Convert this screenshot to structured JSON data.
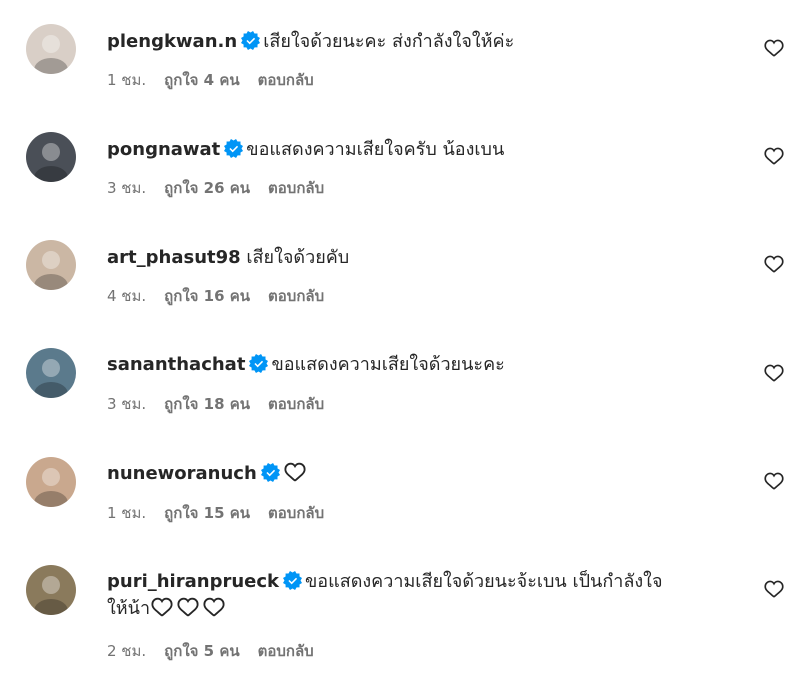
{
  "comments": [
    {
      "username": "plengkwan.n",
      "verified": true,
      "text": "เสียใจด้วยนะคะ ส่งกำลังใจให้ค่ะ",
      "text2": "",
      "hearts": 0,
      "time": "1 ชม.",
      "likes": "ถูกใจ 4 คน",
      "reply": "ตอบกลับ",
      "avatar_color": "#d9cfc7"
    },
    {
      "username": "pongnawat",
      "verified": true,
      "text": "ขอแสดงความเสียใจครับ น้องเบน",
      "text2": "",
      "hearts": 0,
      "time": "3 ชม.",
      "likes": "ถูกใจ 26 คน",
      "reply": "ตอบกลับ",
      "avatar_color": "#4a4f57"
    },
    {
      "username": "art_phasut98",
      "verified": false,
      "text": "เสียใจด้วยคับ",
      "text2": "",
      "hearts": 0,
      "time": "4 ชม.",
      "likes": "ถูกใจ 16 คน",
      "reply": "ตอบกลับ",
      "avatar_color": "#cbb7a4"
    },
    {
      "username": "sananthachat",
      "verified": true,
      "text": "ขอแสดงความเสียใจด้วยนะคะ",
      "text2": "",
      "hearts": 0,
      "time": "3 ชม.",
      "likes": "ถูกใจ 18 คน",
      "reply": "ตอบกลับ",
      "avatar_color": "#5b7a8c"
    },
    {
      "username": "nuneworanuch",
      "verified": true,
      "text": "",
      "text2": "",
      "hearts": 1,
      "time": "1 ชม.",
      "likes": "ถูกใจ 15 คน",
      "reply": "ตอบกลับ",
      "avatar_color": "#c9a88e"
    },
    {
      "username": "puri_hiranprueck",
      "verified": true,
      "text": "ขอแสดงความเสียใจด้วยนะจ้ะเบน เป็นกำลังใจ",
      "text2": "ให้น้า",
      "hearts": 3,
      "time": "2 ชม.",
      "likes": "ถูกใจ 5 คน",
      "reply": "ตอบกลับ",
      "avatar_color": "#8a7a5c"
    }
  ],
  "icons": {
    "verified": "verified-badge-icon",
    "like": "heart-outline-icon"
  },
  "colors": {
    "verified": "#0095f6",
    "text": "#262626",
    "meta": "#737373"
  }
}
